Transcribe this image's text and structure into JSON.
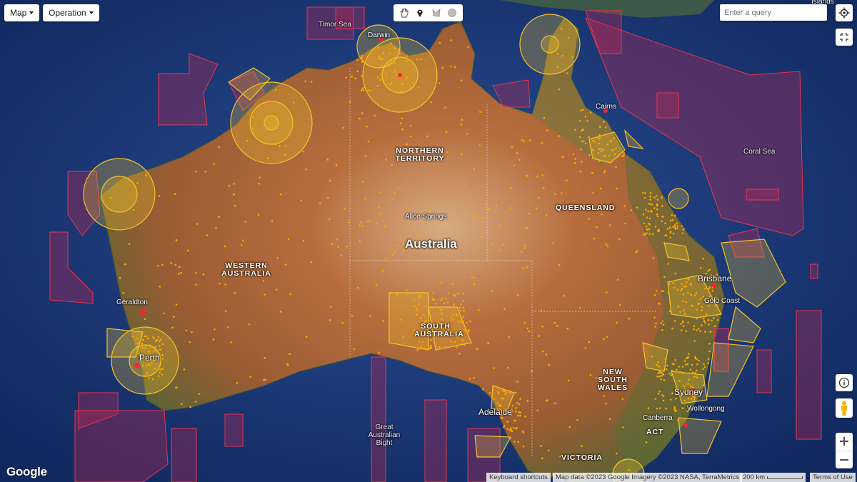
{
  "map_type_menu": {
    "label": "Map"
  },
  "operation_menu": {
    "label": "Operation"
  },
  "toolbar": {
    "tools": [
      {
        "name": "pan-hand-icon"
      },
      {
        "name": "marker-icon"
      },
      {
        "name": "polygon-icon"
      },
      {
        "name": "circle-icon"
      }
    ]
  },
  "search": {
    "placeholder": "Enter a query"
  },
  "labels": {
    "timor_sea": "Timor Sea",
    "darwin": "Darwin",
    "islands": "Islands",
    "cairns": "Cairns",
    "coral_sea": "Coral Sea",
    "northern_territory": "NORTHERN TERRITORY",
    "alice_springs": "Alice Springs",
    "australia": "Australia",
    "queensland": "QUEENSLAND",
    "western_australia": "WESTERN AUSTRALIA",
    "geraldton": "Geraldton",
    "perth": "Perth",
    "south_australia": "SOUTH AUSTRALIA",
    "brisbane": "Brisbane",
    "gold_coast": "Gold Coast",
    "new_south_wales": "NEW SOUTH WALES",
    "sydney": "Sydney",
    "wollongong": "Wollongong",
    "canberra": "Canberra",
    "act": "ACT",
    "adelaide": "Adelaide",
    "great_australian_bight": "Great Australian Bight",
    "victoria": "VICTORIA"
  },
  "attribution": {
    "keyboard": "Keyboard shortcuts",
    "map_data": "Map data ©2023 Google Imagery ©2023 NASA, TerraMetrics",
    "scale": "200 km",
    "terms": "Terms of Use"
  },
  "brand": {
    "logo": "Google"
  },
  "colors": {
    "ocean": "#1d3d7e",
    "land": "#a85a33",
    "restricted_zone": "#c0284f",
    "operation_area": "#f5c22a",
    "points": "#f7a800"
  }
}
